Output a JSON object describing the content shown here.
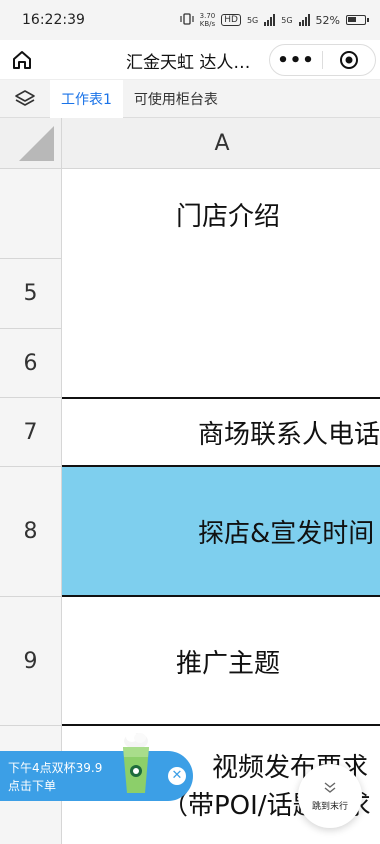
{
  "status": {
    "time": "16:22:39",
    "speed_top": "3.70",
    "speed_bottom": "KB/s",
    "hd": "HD",
    "net1": "5G",
    "net2": "5G",
    "battery": "52%"
  },
  "titlebar": {
    "title": "汇金天虹 达人…",
    "more_label": "•••"
  },
  "tabs": [
    {
      "label": "工作表1",
      "active": true
    },
    {
      "label": "可使用柜台表",
      "active": false
    }
  ],
  "column_header": "A",
  "rows": {
    "r5": "5",
    "r6": "6",
    "r7": "7",
    "r8": "8",
    "r9": "9"
  },
  "cells": {
    "store_intro": "门店介绍",
    "mall_contact": "商场联系人电话",
    "visit_time": "探店&宣发时间",
    "promo_theme": "推广主题",
    "video_req_1": "视频发布要求",
    "video_req_2": "（带POI/话题要求"
  },
  "colors": {
    "highlight": "#7ecfee",
    "accent": "#1a73e8",
    "promo": "#3c9fe6"
  },
  "promo": {
    "line1": "下午4点双杯39.9",
    "line2": "点击下单",
    "close_label": "✕"
  },
  "jump": {
    "label": "跳到末行"
  }
}
